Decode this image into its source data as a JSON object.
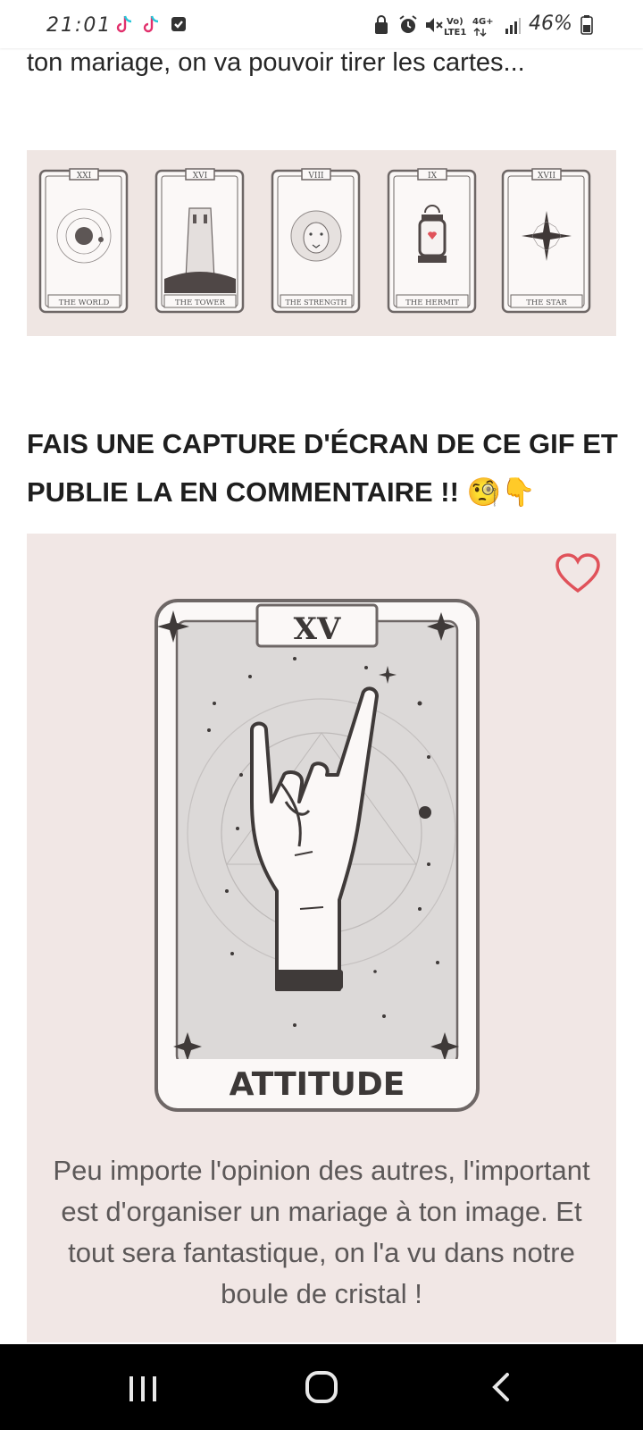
{
  "status_bar": {
    "time": "21:01",
    "network_top": "Vo)",
    "network_bottom": "LTE1",
    "data_type": "4G+",
    "battery": "46%"
  },
  "article": {
    "intro_text": "ton mariage, on va pouvoir tirer les cartes...",
    "cards_strip": [
      {
        "numeral": "XXI",
        "name": "THE WORLD"
      },
      {
        "numeral": "XVI",
        "name": "THE TOWER"
      },
      {
        "numeral": "VIII",
        "name": "THE STRENGTH"
      },
      {
        "numeral": "IX",
        "name": "THE HERMIT"
      },
      {
        "numeral": "XVII",
        "name": "THE STAR"
      }
    ],
    "heading": "FAIS UNE CAPTURE D'ÉCRAN DE CE GIF ET PUBLIE LA EN COMMENTAIRE !! 🧐👇",
    "featured_card": {
      "numeral": "XV",
      "title": "ATTITUDE",
      "description": "Peu importe l'opinion des autres, l'important est d'organiser un mariage à ton image. Et tout sera fantastique, on l'a vu dans notre boule de cristal !"
    }
  },
  "colors": {
    "panel_bg": "#f1e7e5",
    "strip_bg": "#efe6e3",
    "card_ink": "#6e6766",
    "heart": "#e0525a"
  },
  "icons": [
    "tiktok-icon",
    "checkbox-icon",
    "lock-icon",
    "alarm-icon",
    "mute-icon",
    "signal-icon",
    "battery-icon",
    "heart-icon",
    "recent-apps-icon",
    "home-icon",
    "back-icon"
  ]
}
